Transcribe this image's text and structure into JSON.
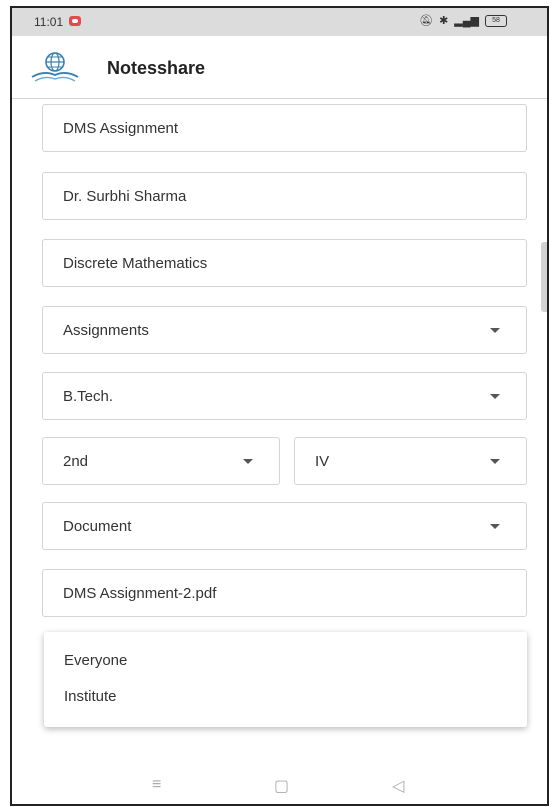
{
  "status_bar": {
    "time": "11:01",
    "icons": [
      "mute-icon",
      "bluetooth-icon",
      "volte-icon",
      "signal-icon"
    ],
    "battery": "58"
  },
  "app_bar": {
    "title": "Notesshare",
    "logo": "globe-book-logo",
    "accent": "#3a7fb0"
  },
  "form": {
    "title": "DMS Assignment",
    "author": "Dr. Surbhi Sharma",
    "subject": "Discrete Mathematics",
    "category": "Assignments",
    "course": "B.Tech.",
    "year": "2nd",
    "semester": "IV",
    "material_type": "Document",
    "file_name": "DMS Assignment-2.pdf"
  },
  "visibility_menu": {
    "options": [
      "Everyone",
      "Institute"
    ]
  },
  "nav_bar": {
    "menu": "≡",
    "home": "▢",
    "back": "◁"
  }
}
